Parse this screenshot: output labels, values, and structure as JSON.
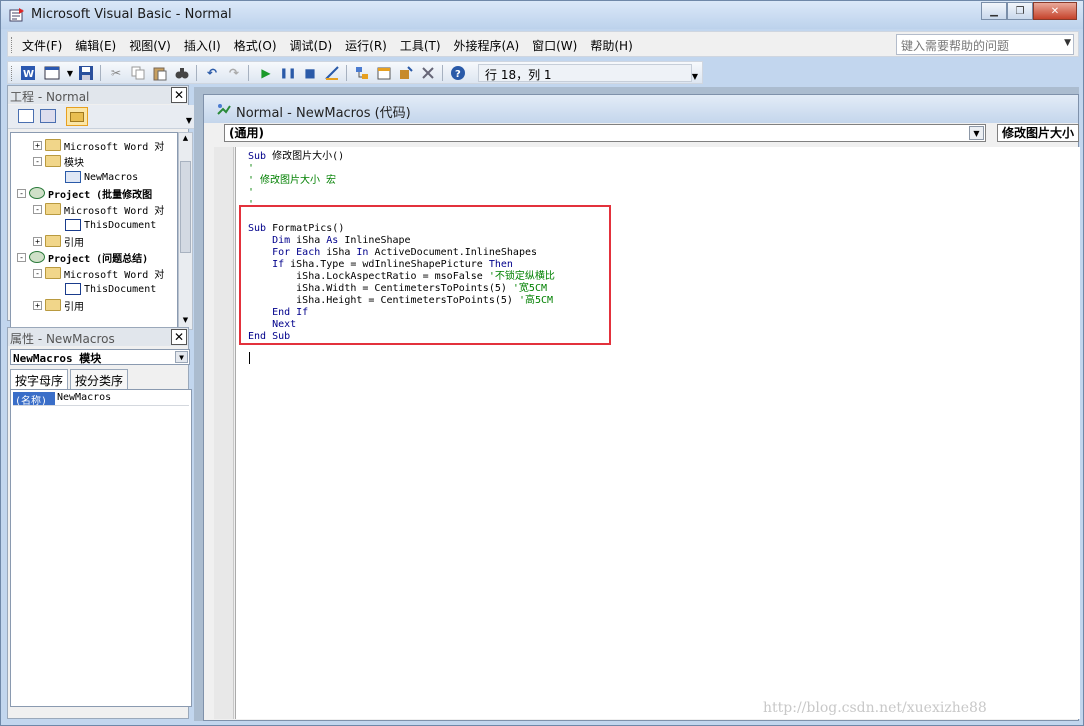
{
  "window": {
    "title": "Microsoft Visual Basic - Normal"
  },
  "menu": {
    "items": [
      "文件(F)",
      "编辑(E)",
      "视图(V)",
      "插入(I)",
      "格式(O)",
      "调试(D)",
      "运行(R)",
      "工具(T)",
      "外接程序(A)",
      "窗口(W)",
      "帮助(H)"
    ],
    "help_placeholder": "键入需要帮助的问题"
  },
  "toolbar": {
    "position": "行 18，列 1"
  },
  "project": {
    "title": "工程 - Normal",
    "tree": [
      {
        "text": "Microsoft Word 对",
        "indent": 1,
        "kind": "folder",
        "exp": "+"
      },
      {
        "text": "模块",
        "indent": 1,
        "kind": "folder",
        "exp": "-"
      },
      {
        "text": "NewMacros",
        "indent": 2,
        "kind": "module",
        "exp": ""
      },
      {
        "text": "Project (批量修改图",
        "indent": 0,
        "kind": "project",
        "exp": "-"
      },
      {
        "text": "Microsoft Word 对",
        "indent": 1,
        "kind": "folder",
        "exp": "-"
      },
      {
        "text": "ThisDocument",
        "indent": 2,
        "kind": "doc",
        "exp": ""
      },
      {
        "text": "引用",
        "indent": 1,
        "kind": "folder",
        "exp": "+"
      },
      {
        "text": "Project (问题总结)",
        "indent": 0,
        "kind": "project",
        "exp": "-"
      },
      {
        "text": "Microsoft Word 对",
        "indent": 1,
        "kind": "folder",
        "exp": "-"
      },
      {
        "text": "ThisDocument",
        "indent": 2,
        "kind": "doc",
        "exp": ""
      },
      {
        "text": "引用",
        "indent": 1,
        "kind": "folder",
        "exp": "+"
      }
    ]
  },
  "properties": {
    "title": "属性 - NewMacros",
    "object": "NewMacros 模块",
    "tabs": [
      "按字母序",
      "按分类序"
    ],
    "rows": [
      {
        "key": "(名称)",
        "value": "NewMacros"
      }
    ]
  },
  "code_window": {
    "title": "Normal - NewMacros (代码)",
    "object_combo": "(通用)",
    "proc_combo": "修改图片大小",
    "lines": [
      {
        "segments": [
          {
            "t": "Sub ",
            "c": "kw"
          },
          {
            "t": "修改图片大小()",
            "c": ""
          }
        ]
      },
      {
        "segments": [
          {
            "t": "'",
            "c": "cm"
          }
        ]
      },
      {
        "segments": [
          {
            "t": "' 修改图片大小 宏",
            "c": "cm"
          }
        ]
      },
      {
        "segments": [
          {
            "t": "'",
            "c": "cm"
          }
        ]
      },
      {
        "segments": [
          {
            "t": "'",
            "c": "cm"
          }
        ]
      },
      {
        "segments": []
      },
      {
        "segments": [
          {
            "t": "Sub ",
            "c": "kw"
          },
          {
            "t": "FormatPics()",
            "c": ""
          }
        ]
      },
      {
        "segments": [
          {
            "t": "    Dim ",
            "c": "kw"
          },
          {
            "t": "iSha ",
            "c": ""
          },
          {
            "t": "As ",
            "c": "kw"
          },
          {
            "t": "InlineShape",
            "c": ""
          }
        ]
      },
      {
        "segments": [
          {
            "t": "    For Each ",
            "c": "kw"
          },
          {
            "t": "iSha ",
            "c": ""
          },
          {
            "t": "In ",
            "c": "kw"
          },
          {
            "t": "ActiveDocument.InlineShapes",
            "c": ""
          }
        ]
      },
      {
        "segments": [
          {
            "t": "    If ",
            "c": "kw"
          },
          {
            "t": "iSha.Type = wdInlineShapePicture ",
            "c": ""
          },
          {
            "t": "Then",
            "c": "kw"
          }
        ]
      },
      {
        "segments": [
          {
            "t": "        iSha.LockAspectRatio = msoFalse ",
            "c": ""
          },
          {
            "t": "'不锁定纵横比",
            "c": "cm"
          }
        ]
      },
      {
        "segments": [
          {
            "t": "        iSha.Width = CentimetersToPoints(5) ",
            "c": ""
          },
          {
            "t": "'宽5CM",
            "c": "cm"
          }
        ]
      },
      {
        "segments": [
          {
            "t": "        iSha.Height = CentimetersToPoints(5) ",
            "c": ""
          },
          {
            "t": "'高5CM",
            "c": "cm"
          }
        ]
      },
      {
        "segments": [
          {
            "t": "    End If",
            "c": "kw"
          }
        ]
      },
      {
        "segments": [
          {
            "t": "    Next",
            "c": "kw"
          }
        ]
      },
      {
        "segments": [
          {
            "t": "End Sub",
            "c": "kw"
          }
        ]
      }
    ],
    "watermark": "http://blog.csdn.net/xuexizhe88"
  },
  "colors": {
    "highlight_box": "#e3313c",
    "keyword": "#00008b",
    "comment": "#008000"
  }
}
